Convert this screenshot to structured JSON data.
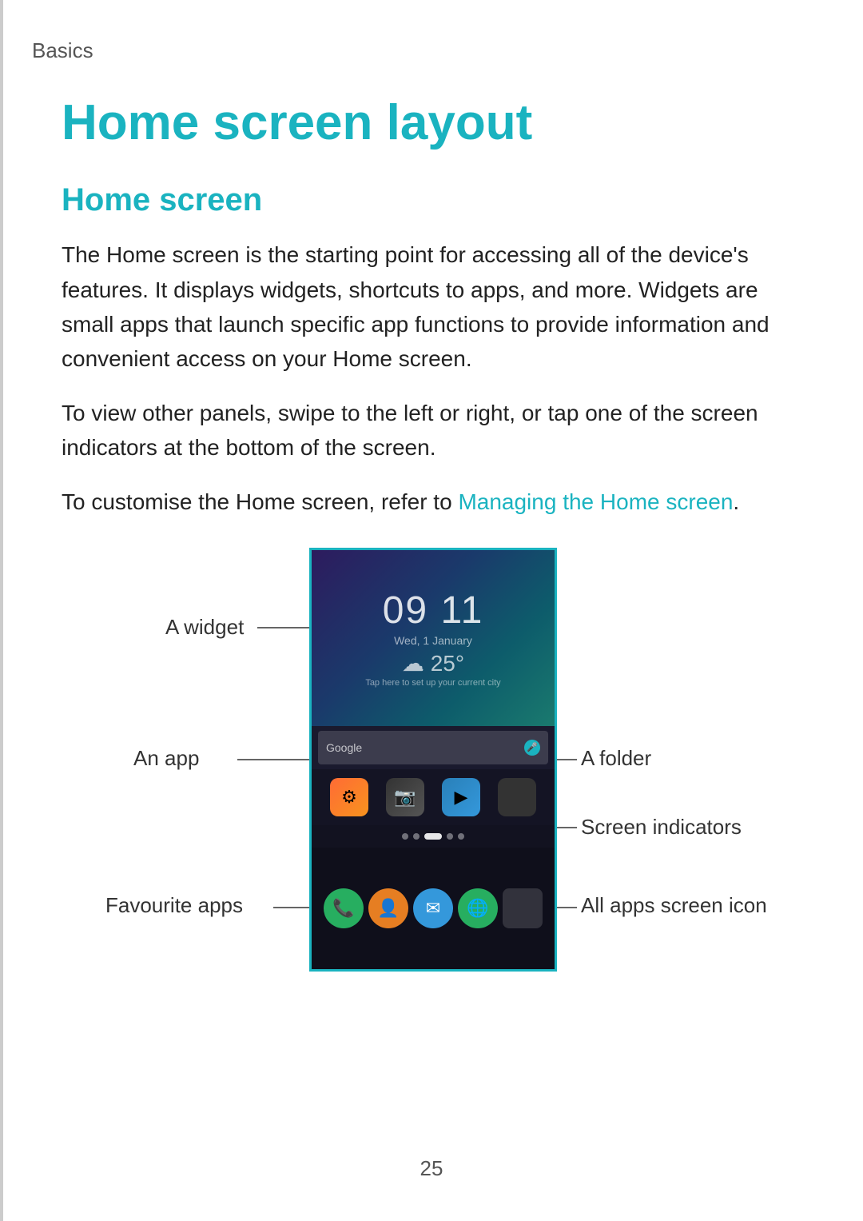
{
  "breadcrumb": {
    "label": "Basics"
  },
  "page": {
    "title": "Home screen layout",
    "section_title": "Home screen",
    "paragraph1": "The Home screen is the starting point for accessing all of the device's features. It displays widgets, shortcuts to apps, and more. Widgets are small apps that launch specific app functions to provide information and convenient access on your Home screen.",
    "paragraph2": "To view other panels, swipe to the left or right, or tap one of the screen indicators at the bottom of the screen.",
    "paragraph3_before_link": "To customise the Home screen, refer to ",
    "link_text": "Managing the Home screen",
    "paragraph3_after_link": ".",
    "page_number": "25"
  },
  "diagram": {
    "labels": {
      "a_widget": "A widget",
      "an_app": "An app",
      "favourite_apps": "Favourite apps",
      "a_folder": "A folder",
      "screen_indicators": "Screen indicators",
      "all_apps_screen_icon": "All apps screen icon"
    }
  },
  "phone": {
    "time": "09 11",
    "date": "Wed, 1 January",
    "weather_temp": "25",
    "search_placeholder": "Google",
    "apps": [
      "settings",
      "camera",
      "play",
      "folder"
    ],
    "indicators": [
      false,
      false,
      true,
      false,
      false
    ],
    "fav_apps": [
      "phone",
      "contacts",
      "email",
      "browser",
      "apps-grid"
    ]
  }
}
